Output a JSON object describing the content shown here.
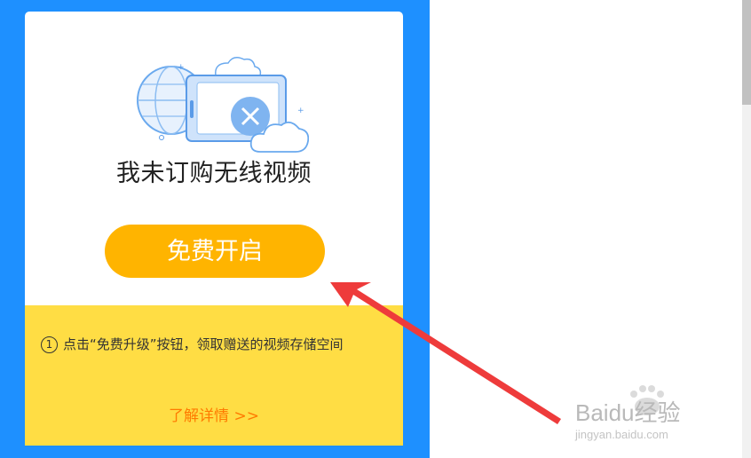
{
  "card": {
    "title": "我未订购无线视频",
    "cta_label": "免费开启"
  },
  "info": {
    "step_number": "1",
    "text": "点击“免费升级”按钮，领取赠送的视频存储空间",
    "link_label": "了解详情 >>"
  },
  "watermark": {
    "brand": "Baidu经验",
    "url": "jingyan.baidu.com"
  },
  "icons": {
    "illustration": "no-video-cloud-illustration",
    "arrow": "red-pointer-arrow"
  },
  "colors": {
    "panel": "#1e90ff",
    "cta": "#ffb400",
    "info_bg": "#ffdd44",
    "link": "#ff7a00",
    "arrow": "#ee3b3b"
  }
}
